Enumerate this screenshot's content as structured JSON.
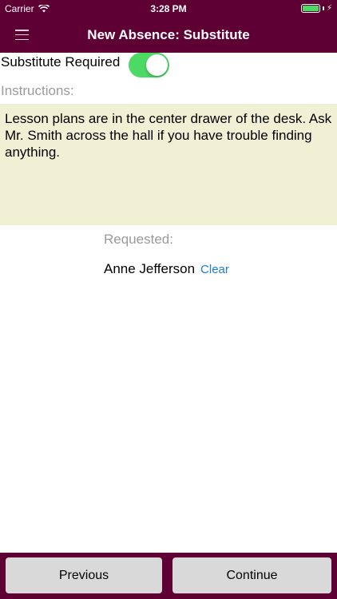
{
  "status_bar": {
    "carrier": "Carrier",
    "time": "3:28 PM",
    "charge_glyph": "⚡"
  },
  "nav": {
    "title": "New Absence: Substitute"
  },
  "substitute": {
    "label": "Substitute Required",
    "enabled": true
  },
  "instructions": {
    "label": "Instructions:",
    "value": "Lesson plans are in the center drawer of the desk. Ask Mr. Smith across the hall if you have trouble finding anything."
  },
  "requested": {
    "label": "Requested:",
    "name": "Anne Jefferson",
    "clear_label": "Clear"
  },
  "footer": {
    "previous_label": "Previous",
    "continue_label": "Continue"
  },
  "colors": {
    "brand": "#5f0035",
    "toggle_on": "#4cd964",
    "instructions_bg": "#f2f0d4",
    "link": "#1f7bd0",
    "button_bg": "#d9d9d9"
  },
  "icons": {
    "menu": "hamburger-menu-icon",
    "wifi": "wifi-icon",
    "battery": "battery-icon"
  }
}
